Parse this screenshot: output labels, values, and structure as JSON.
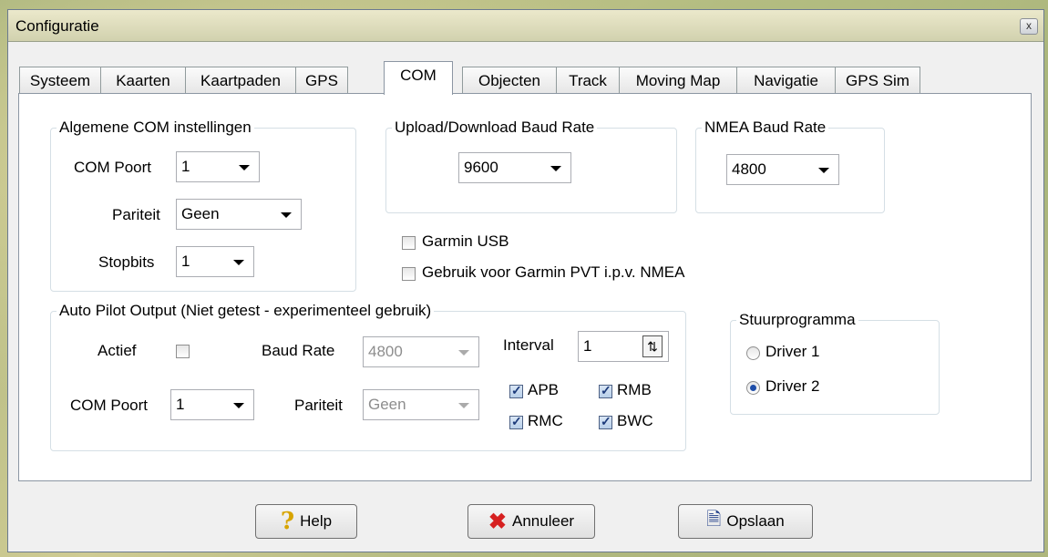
{
  "window": {
    "title": "Configuratie",
    "close_label": "x"
  },
  "tabs": [
    "Systeem",
    "Kaarten",
    "Kaartpaden",
    "GPS",
    "COM",
    "Objecten",
    "Track",
    "Moving Map",
    "Navigatie",
    "GPS Sim"
  ],
  "active_tab": "COM",
  "general": {
    "legend": "Algemene COM instellingen",
    "com_port_label": "COM Poort",
    "com_port_value": "1",
    "parity_label": "Pariteit",
    "parity_value": "Geen",
    "stopbits_label": "Stopbits",
    "stopbits_value": "1"
  },
  "upload": {
    "legend": "Upload/Download Baud Rate",
    "value": "9600"
  },
  "nmea": {
    "legend": "NMEA Baud Rate",
    "value": "4800"
  },
  "garmin": {
    "usb_label": "Garmin USB",
    "usb_checked": false,
    "pvt_label": "Gebruik voor Garmin PVT i.p.v. NMEA",
    "pvt_checked": false
  },
  "autopilot": {
    "legend": "Auto Pilot Output (Niet getest - experimenteel gebruik)",
    "active_label": "Actief",
    "active_checked": false,
    "baud_label": "Baud Rate",
    "baud_value": "4800",
    "com_port_label": "COM Poort",
    "com_port_value": "1",
    "parity_label": "Pariteit",
    "parity_value": "Geen",
    "interval_label": "Interval",
    "interval_value": "1",
    "apb": "APB",
    "rmb": "RMB",
    "rmc": "RMC",
    "bwc": "BWC"
  },
  "driver": {
    "legend": "Stuurprogramma",
    "driver1": "Driver 1",
    "driver2": "Driver 2",
    "selected": "Driver 2"
  },
  "buttons": {
    "help": "Help",
    "cancel": "Annuleer",
    "save": "Opslaan"
  }
}
